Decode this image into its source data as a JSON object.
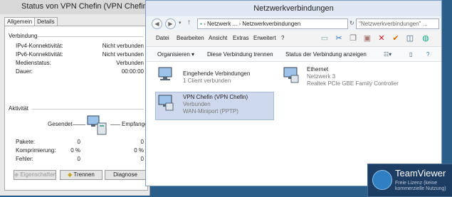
{
  "status_window": {
    "title": "Status von VPN Chefin (VPN Chefin)",
    "tabs": [
      {
        "label": "Allgemein",
        "active": true
      },
      {
        "label": "Details",
        "active": false
      }
    ],
    "connection_section": "Verbindung",
    "rows": [
      {
        "label": "IPv4-Konnektivität:",
        "value": "Nicht verbunden"
      },
      {
        "label": "IPv6-Konnektivität:",
        "value": "Nicht verbunden"
      },
      {
        "label": "Medienstatus:",
        "value": "Verbunden"
      },
      {
        "label": "Dauer:",
        "value": "00:00:00"
      }
    ],
    "activity_section": "Aktivität",
    "sent_label": "Gesendet",
    "received_label": "Empfangen",
    "stats": [
      {
        "label": "Pakete:",
        "sent": "0",
        "received": "0"
      },
      {
        "label": "Komprimierung:",
        "sent": "0 %",
        "received": "0 %"
      },
      {
        "label": "Fehler:",
        "sent": "0",
        "received": "0"
      }
    ],
    "buttons": {
      "properties": "Eigenschaften",
      "disconnect": "Trennen",
      "diagnose": "Diagnose"
    }
  },
  "net_window": {
    "title": "Netzwerkverbindungen",
    "breadcrumb": [
      "Netzwerk ...",
      "Netzwerkverbindungen"
    ],
    "search_placeholder": "\"Netzwerkverbindungen\" ...",
    "menu": [
      "Datei",
      "Bearbeiten",
      "Ansicht",
      "Extras",
      "Erweitert",
      "?"
    ],
    "commands": {
      "organize": "Organisieren",
      "disconnect": "Diese Verbindung trennen",
      "status": "Status der Verbindung anzeigen"
    },
    "items": [
      {
        "name": "Eingehende Verbindungen",
        "line2": "1 Client verbunden",
        "line3": ""
      },
      {
        "name": "Ethernet",
        "line2": "Netzwerk  3",
        "line3": "Realtek PCIe GBE Family Controller"
      },
      {
        "name": "VPN Chefin (VPN Chefin)",
        "line2": "Verbunden",
        "line3": "WAN-Miniport (PPTP)"
      }
    ]
  },
  "teamviewer": {
    "title": "TeamViewer",
    "subtitle": "Freie Lizenz (keine kommerzielle Nutzung)"
  },
  "colors": {
    "accent": "#2f7fc2",
    "selection": "#cfd9ee",
    "desktop": "#2b5f8a"
  }
}
